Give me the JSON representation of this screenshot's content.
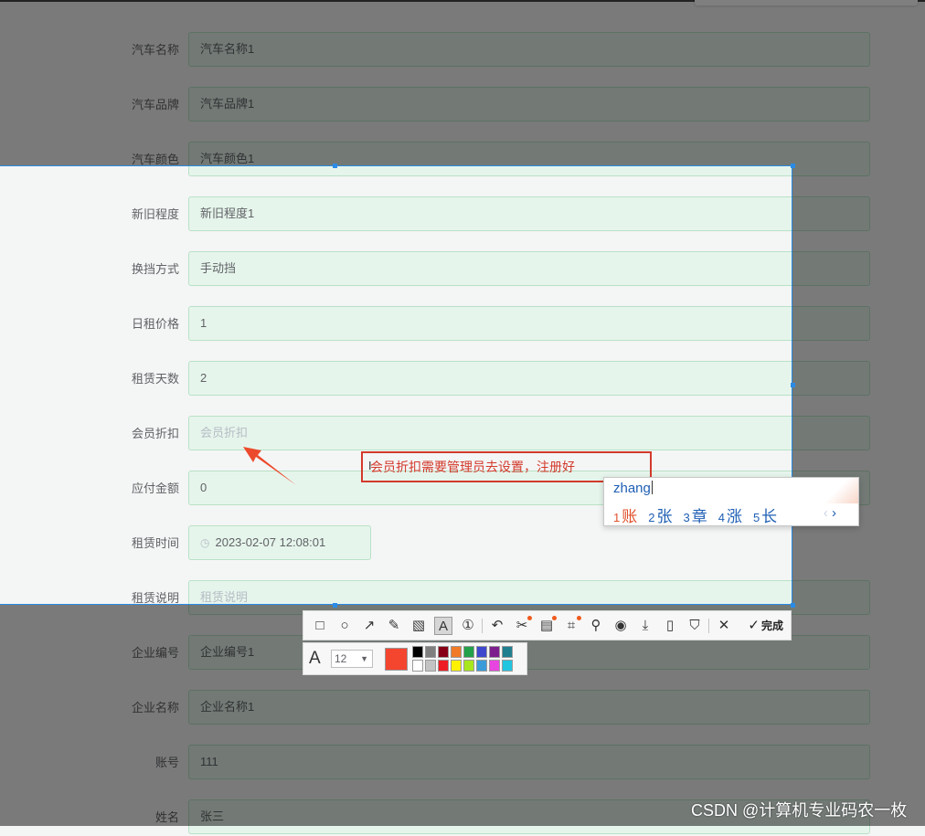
{
  "form": {
    "rows": [
      {
        "label": "汽车名称",
        "value": "汽车名称1",
        "placeholder": false
      },
      {
        "label": "汽车品牌",
        "value": "汽车品牌1",
        "placeholder": false
      },
      {
        "label": "汽车颜色",
        "value": "汽车颜色1",
        "placeholder": false
      },
      {
        "label": "新旧程度",
        "value": "新旧程度1",
        "placeholder": false
      },
      {
        "label": "换挡方式",
        "value": "手动挡",
        "placeholder": false
      },
      {
        "label": "日租价格",
        "value": "1",
        "placeholder": false
      },
      {
        "label": "租赁天数",
        "value": "2",
        "placeholder": false
      },
      {
        "label": "会员折扣",
        "value": "会员折扣",
        "placeholder": true
      },
      {
        "label": "应付金额",
        "value": "0",
        "placeholder": false
      },
      {
        "label": "租赁时间",
        "value": "2023-02-07 12:08:01",
        "placeholder": false
      },
      {
        "label": "租赁说明",
        "value": "租赁说明",
        "placeholder": true
      },
      {
        "label": "企业编号",
        "value": "企业编号1",
        "placeholder": false
      },
      {
        "label": "企业名称",
        "value": "企业名称1",
        "placeholder": false
      },
      {
        "label": "账号",
        "value": "111",
        "placeholder": false
      },
      {
        "label": "姓名",
        "value": "张三",
        "placeholder": false
      }
    ]
  },
  "annotation": {
    "text": "会员折扣需要管理员去设置，注册好",
    "color": "#d33a2c"
  },
  "ime": {
    "composition": "zhang",
    "candidates": [
      {
        "num": "1",
        "char": "账"
      },
      {
        "num": "2",
        "char": "张"
      },
      {
        "num": "3",
        "char": "章"
      },
      {
        "num": "4",
        "char": "涨"
      },
      {
        "num": "5",
        "char": "长"
      }
    ],
    "prev": "‹",
    "next": "›"
  },
  "toolbar": {
    "tools": [
      {
        "name": "rectangle-tool",
        "icon": "□"
      },
      {
        "name": "ellipse-tool",
        "icon": "○"
      },
      {
        "name": "arrow-tool",
        "icon": "↗"
      },
      {
        "name": "pen-tool",
        "icon": "✎"
      },
      {
        "name": "mosaic-tool",
        "icon": "▧"
      },
      {
        "name": "text-tool",
        "icon": "A"
      },
      {
        "name": "number-tool",
        "icon": "①"
      },
      {
        "name": "undo-tool",
        "icon": "↶"
      },
      {
        "name": "scissors-tool",
        "icon": "✂"
      },
      {
        "name": "ocr-tool",
        "icon": "▤"
      },
      {
        "name": "translate-tool",
        "icon": "⌗"
      },
      {
        "name": "pin-tool",
        "icon": "⚲"
      },
      {
        "name": "record-tool",
        "icon": "◉"
      },
      {
        "name": "download-tool",
        "icon": "⤓"
      },
      {
        "name": "phone-tool",
        "icon": "▯"
      },
      {
        "name": "bookmark-tool",
        "icon": "⛉"
      },
      {
        "name": "cancel-tool",
        "icon": "✕"
      }
    ],
    "done_icon": "✓",
    "done_label": "完成"
  },
  "subtoolbar": {
    "font_icon": "A",
    "font_size": "12",
    "current_color": "#f4452f",
    "palette": [
      "#000000",
      "#7f7f7f",
      "#880015",
      "#f07a27",
      "#22a14a",
      "#3f48cc",
      "#7e1f8e",
      "#1f7f8f",
      "",
      "#ffffff",
      "#c3c3c3",
      "#ed1c24",
      "#fff200",
      "#a8e61d",
      "#3a9bd9",
      "#e844e0",
      "#20c6e0",
      ""
    ]
  },
  "watermark": "CSDN @计算机专业码农一枚"
}
